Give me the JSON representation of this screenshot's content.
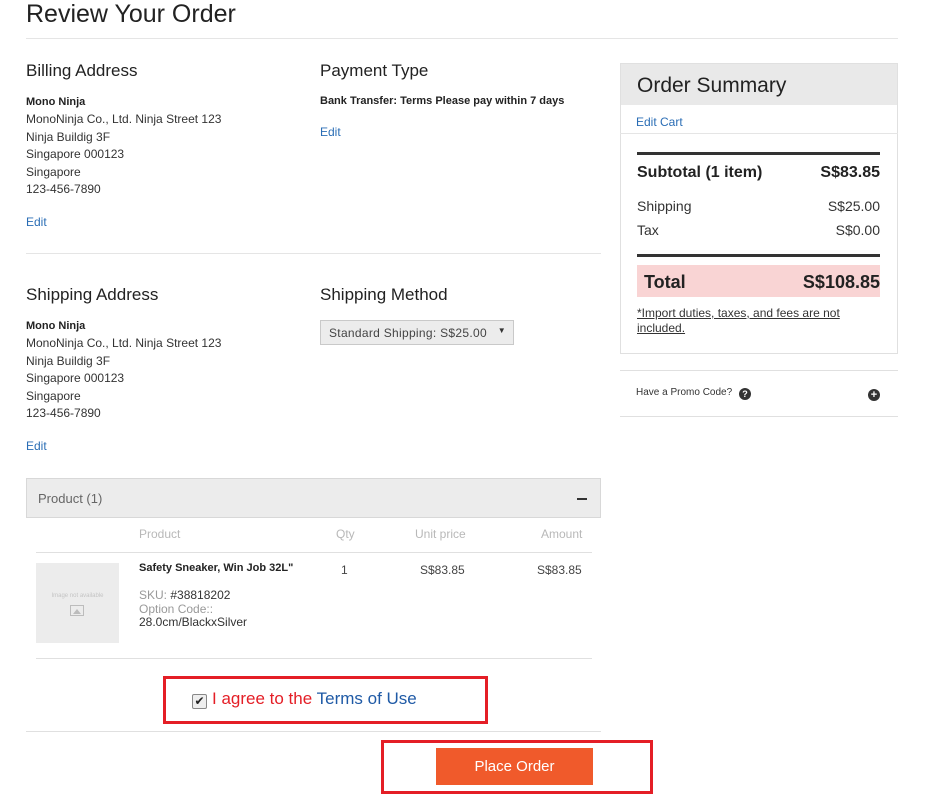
{
  "page": {
    "title": "Review Your Order"
  },
  "billing": {
    "heading": "Billing Address",
    "name": "Mono Ninja",
    "lines": [
      "MonoNinja Co., Ltd. Ninja Street 123",
      "Ninja Buildig 3F",
      "Singapore 000123",
      "Singapore",
      "123-456-7890"
    ],
    "edit": "Edit"
  },
  "payment": {
    "heading": "Payment Type",
    "value": "Bank Transfer: Terms Please pay within 7 days",
    "edit": "Edit"
  },
  "shipping_address": {
    "heading": "Shipping Address",
    "name": "Mono Ninja",
    "lines": [
      "MonoNinja Co., Ltd. Ninja Street 123",
      "Ninja Buildig 3F",
      "Singapore 000123",
      "Singapore",
      "123-456-7890"
    ],
    "edit": "Edit"
  },
  "shipping_method": {
    "heading": "Shipping Method",
    "selected": "Standard Shipping: S$25.00"
  },
  "products": {
    "section_label": "Product (1)",
    "columns": [
      "Product",
      "Qty",
      "Unit price",
      "Amount"
    ],
    "rows": [
      {
        "thumb_text": "Image not available",
        "name": "Safety Sneaker, Win Job 32L\"",
        "sku_label": "SKU:",
        "sku": "#38818202",
        "option_label": "Option Code::",
        "option": "28.0cm/BlackxSilver",
        "qty": "1",
        "unit_price": "S$83.85",
        "amount": "S$83.85"
      }
    ]
  },
  "agreement": {
    "prefix": "I agree to the ",
    "link": "Terms of Use",
    "checked": true
  },
  "place_order": "Place Order",
  "summary": {
    "heading": "Order Summary",
    "edit_cart": "Edit Cart",
    "subtotal_label": "Subtotal (1 item)",
    "subtotal": "S$83.85",
    "shipping_label": "Shipping",
    "shipping": "S$25.00",
    "tax_label": "Tax",
    "tax": "S$0.00",
    "total_label": "Total",
    "total": "S$108.85",
    "import_note": "*Import duties, taxes, and fees are not included."
  },
  "promo": {
    "label": "Have a Promo Code?",
    "question_icon": "question-icon",
    "expand_icon": "plus-icon"
  },
  "colors": {
    "accent": "#f05a2b",
    "highlight_box": "#e41e26",
    "link": "#2a6db5",
    "total_bg": "#f9d4d4"
  }
}
